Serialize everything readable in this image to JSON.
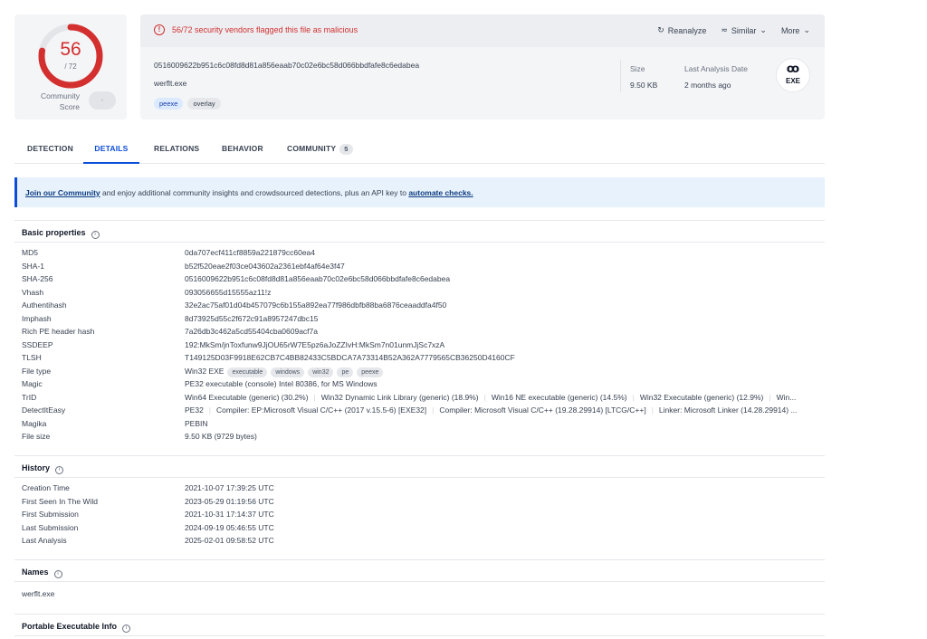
{
  "score": {
    "detections": "56",
    "total": "/ 72",
    "community_label": "Community Score",
    "community_value": "-",
    "ratio": 0.778,
    "color": "#d32f2f"
  },
  "header": {
    "alert": "56/72 security vendors flagged this file as malicious",
    "reanalyze": "Reanalyze",
    "similar": "Similar",
    "more": "More",
    "hash": "0516009622b951c6c08fd8d81a856eaab70c02e6bc58d066bbdfafe8c6edabea",
    "filename": "werflt.exe",
    "tags": [
      "peexe",
      "overlay"
    ],
    "size_label": "Size",
    "size_value": "9.50 KB",
    "last_analysis_label": "Last Analysis Date",
    "last_analysis_value": "2 months ago",
    "file_icon": "EXE"
  },
  "tabs": [
    {
      "label": "DETECTION"
    },
    {
      "label": "DETAILS"
    },
    {
      "label": "RELATIONS"
    },
    {
      "label": "BEHAVIOR"
    },
    {
      "label": "COMMUNITY",
      "badge": "5"
    }
  ],
  "banner": {
    "link1": "Join our Community",
    "middle": " and enjoy additional community insights and crowdsourced detections, plus an API key to ",
    "link2": "automate checks."
  },
  "basic": {
    "title": "Basic properties",
    "rows": [
      {
        "k": "MD5",
        "v": "0da707ecf411cf8859a221879cc60ea4"
      },
      {
        "k": "SHA-1",
        "v": "b52f520eae2f03ce043602a2361ebf4af64e3f47"
      },
      {
        "k": "SHA-256",
        "v": "0516009622b951c6c08fd8d81a856eaab70c02e6bc58d066bbdfafe8c6edabea"
      },
      {
        "k": "Vhash",
        "v": "093056655d15555az11!z"
      },
      {
        "k": "Authentihash",
        "v": "32e2ac75af01d04b457079c6b155a892ea77f986dbfb88ba6876ceaaddfa4f50"
      },
      {
        "k": "Imphash",
        "v": "8d73925d55c2f672c91a8957247dbc15"
      },
      {
        "k": "Rich PE header hash",
        "v": "7a26db3c462a5cd55404cba0609acf7a"
      },
      {
        "k": "SSDEEP",
        "v": "192:MkSm/jnToxfunw9JjOU65rW7E5pz6aJoZZIvH:MkSm7n01unmJjSc7xzA"
      },
      {
        "k": "TLSH",
        "v": "T149125D03F9918E62CB7C4BB82433C5BDCA7A73314B52A362A7779565CB36250D4160CF"
      },
      {
        "k": "File type",
        "v": "Win32 EXE",
        "chips": [
          "executable",
          "windows",
          "win32",
          "pe",
          "peexe"
        ]
      },
      {
        "k": "Magic",
        "v": "PE32 executable (console) Intel 80386, for MS Windows"
      },
      {
        "k": "TrID",
        "parts": [
          "Win64 Executable (generic) (30.2%)",
          "Win32 Dynamic Link Library (generic) (18.9%)",
          "Win16 NE executable (generic) (14.5%)",
          "Win32 Executable (generic) (12.9%)",
          "Win..."
        ]
      },
      {
        "k": "DetectItEasy",
        "parts": [
          "PE32",
          "Compiler: EP:Microsoft Visual C/C++ (2017 v.15.5-6) [EXE32]",
          "Compiler: Microsoft Visual C/C++ (19.28.29914) [LTCG/C++]",
          "Linker: Microsoft Linker (14.28.29914) ..."
        ]
      },
      {
        "k": "Magika",
        "v": "PEBIN"
      },
      {
        "k": "File size",
        "v": "9.50 KB (9729 bytes)"
      }
    ]
  },
  "history": {
    "title": "History",
    "rows": [
      {
        "k": "Creation Time",
        "v": "2021-10-07 17:39:25 UTC"
      },
      {
        "k": "First Seen In The Wild",
        "v": "2023-05-29 01:19:56 UTC"
      },
      {
        "k": "First Submission",
        "v": "2021-10-31 17:14:37 UTC"
      },
      {
        "k": "Last Submission",
        "v": "2024-09-19 05:46:55 UTC"
      },
      {
        "k": "Last Analysis",
        "v": "2025-02-01 09:58:52 UTC"
      }
    ]
  },
  "names": {
    "title": "Names",
    "value": "werflt.exe"
  },
  "pe_info": {
    "title": "Portable Executable Info"
  }
}
